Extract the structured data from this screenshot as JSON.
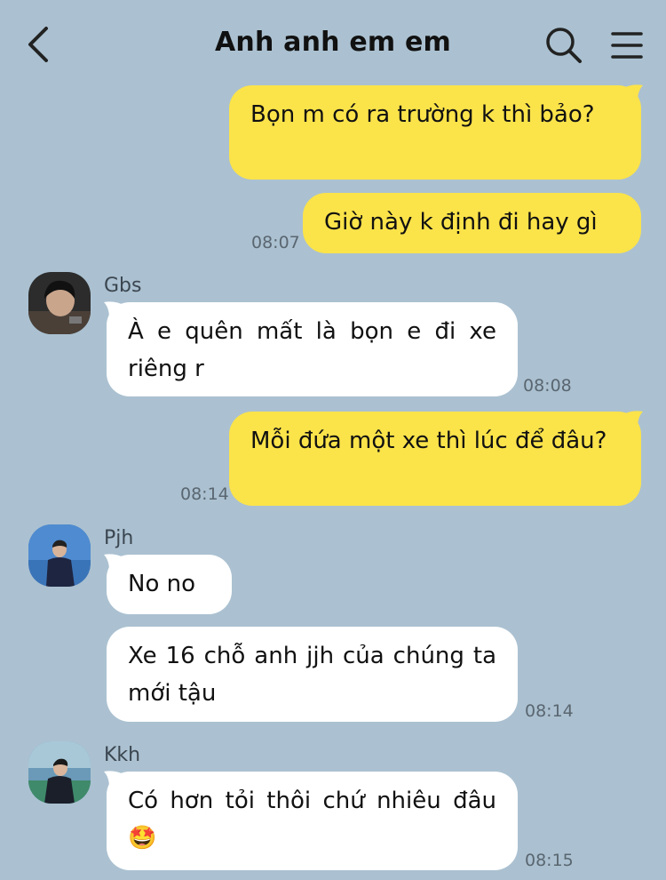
{
  "header": {
    "title": "Anh anh em em",
    "back_icon": "chevron-left-icon",
    "search_icon": "search-icon",
    "menu_icon": "menu-icon"
  },
  "colors": {
    "background": "#abc1d1",
    "my_bubble": "#fbe34a",
    "their_bubble": "#ffffff"
  },
  "messages": [
    {
      "sender": "me",
      "text": "Bọn m có ra trường k thì bảo?",
      "time": ""
    },
    {
      "sender": "me",
      "text": "Giờ này k định đi hay gì",
      "time": "08:07"
    },
    {
      "sender": "Gbs",
      "text": "À e quên mất là bọn e đi xe riêng r",
      "time": "08:08"
    },
    {
      "sender": "me",
      "text": "Mỗi đứa một xe thì lúc để đâu?",
      "time": "08:14"
    },
    {
      "sender": "Pjh",
      "text": "No no",
      "time": ""
    },
    {
      "sender": "Pjh",
      "text": "Xe 16 chỗ anh jjh của chúng ta mới tậu",
      "time": "08:14"
    },
    {
      "sender": "Kkh",
      "text": "Có hơn tỏi thôi chứ nhiêu đâu🤩",
      "time": "08:15"
    }
  ]
}
